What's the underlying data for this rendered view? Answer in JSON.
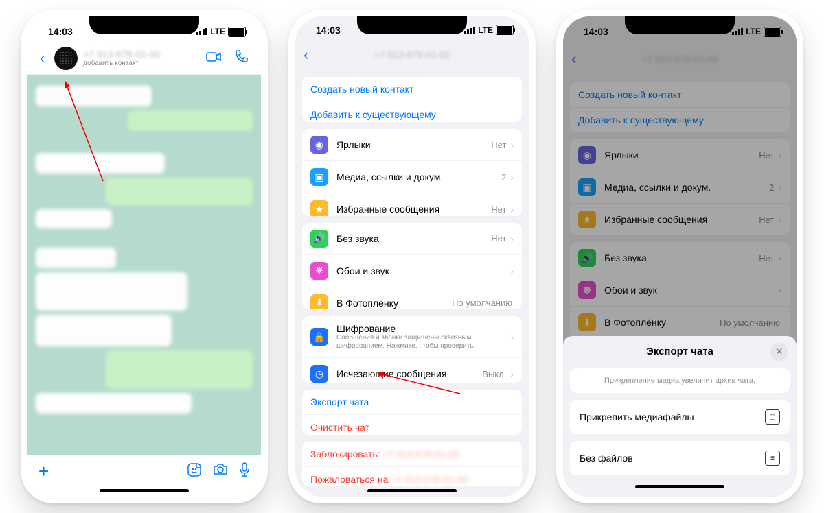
{
  "status": {
    "time": "14:03",
    "net": "LTE"
  },
  "s1": {
    "add_contact": "добавить контакт"
  },
  "settings": {
    "create": "Создать новый контакт",
    "add_existing": "Добавить к существующему",
    "labels": "Ярлыки",
    "labels_val": "Нет",
    "media": "Медиа, ссылки и докум.",
    "media_val": "2",
    "starred": "Избранные сообщения",
    "starred_val": "Нет",
    "mute": "Без звука",
    "mute_val": "Нет",
    "wallpaper": "Обои и звук",
    "camera_roll": "В Фотоплёнку",
    "camera_roll_val": "По умолчанию",
    "encryption": "Шифрование",
    "encryption_sub": "Сообщения и звонки защищены сквозным шифрованием. Нажмите, чтобы проверить.",
    "disappearing": "Исчезающие сообщения",
    "disappearing_val": "Выкл.",
    "export": "Экспорт чата",
    "clear": "Очистить чат",
    "block": "Заблокировать:",
    "report": "Пожаловаться на"
  },
  "sheet": {
    "title": "Экспорт чата",
    "info": "Прикрепление медиа увеличит архив чата.",
    "with_media": "Прикрепить медиафайлы",
    "without": "Без файлов"
  }
}
